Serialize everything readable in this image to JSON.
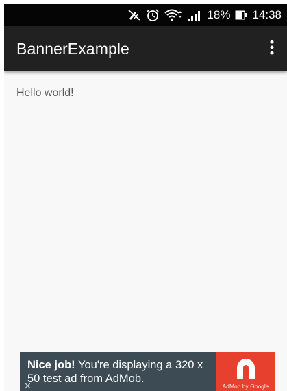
{
  "status_bar": {
    "icons": [
      "mute-icon",
      "alarm-icon",
      "wifi-icon",
      "signal-icon",
      "battery-icon"
    ],
    "battery_percent": "18%",
    "time": "14:38"
  },
  "app_bar": {
    "title": "BannerExample",
    "overflow_icon": "more-vert-icon"
  },
  "content": {
    "text": "Hello world!"
  },
  "ad_banner": {
    "headline_bold": "Nice job!",
    "headline_rest": " You're displaying a 320 x 50 test ad from AdMob.",
    "close_label": "✕",
    "logo_caption": "AdMob by Google",
    "logo_color": "#e8402f",
    "background_color": "#3d4b55"
  },
  "colors": {
    "status_bar": "#050505",
    "app_bar": "#212121",
    "page_background": "#f8f8f8"
  }
}
